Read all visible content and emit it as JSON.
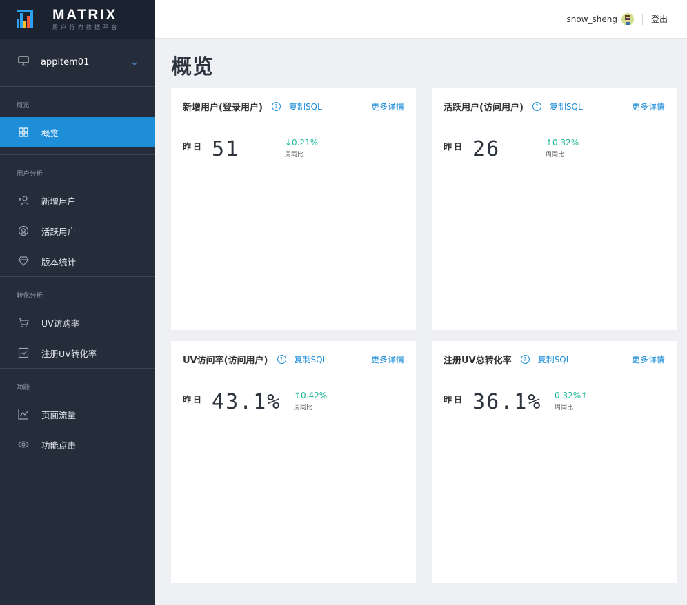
{
  "brand": {
    "name": "MATRIX",
    "subtitle": "用户行为数据平台",
    "colors": [
      "#2aa1f1",
      "#f5c02b",
      "#ee5c3b",
      "#2aa1f1",
      "#45c07a"
    ]
  },
  "sidebar": {
    "app_select": {
      "value": "appitem01",
      "icon": "monitor-icon"
    },
    "groups": [
      {
        "title": "概览",
        "items": [
          {
            "label": "概览",
            "icon": "dashboard-icon",
            "active": true
          }
        ]
      },
      {
        "title": "用户分析",
        "items": [
          {
            "label": "新增用户",
            "icon": "add-user-icon"
          },
          {
            "label": "活跃用户",
            "icon": "user-circle-icon"
          },
          {
            "label": "版本统计",
            "icon": "diamond-icon"
          }
        ]
      },
      {
        "title": "转化分析",
        "items": [
          {
            "label": "UV访购率",
            "icon": "cart-icon"
          },
          {
            "label": "注册UV转化率",
            "icon": "chart-box-icon"
          }
        ]
      },
      {
        "title": "功能",
        "items": [
          {
            "label": "页面流量",
            "icon": "line-chart-icon"
          },
          {
            "label": "功能点击",
            "icon": "eye-icon"
          }
        ]
      }
    ]
  },
  "header": {
    "username": "snow_sheng",
    "logout": "登出"
  },
  "page_title": "概览",
  "cards": [
    {
      "title": "新增用户(登录用户)",
      "copy": "复制SQL",
      "more": "更多详情",
      "label": "昨日",
      "value": "51",
      "change": "↓0.21%",
      "change_label": "周同比"
    },
    {
      "title": "活跃用户(访问用户)",
      "copy": "复制SQL",
      "more": "更多详情",
      "label": "昨日",
      "value": "26",
      "change": "↑0.32%",
      "change_label": "周同比"
    },
    {
      "title": "UV访问率(访问用户)",
      "copy": "复制SQL",
      "more": "更多详情",
      "label": "昨日",
      "value": "43.1%",
      "change": "↑0.42%",
      "change_label": "周同比"
    },
    {
      "title": "注册UV总转化率",
      "copy": "复制SQL",
      "more": "更多详情",
      "label": "昨日",
      "value": "36.1%",
      "change": "0.32%↑",
      "change_label": "周同比"
    }
  ]
}
